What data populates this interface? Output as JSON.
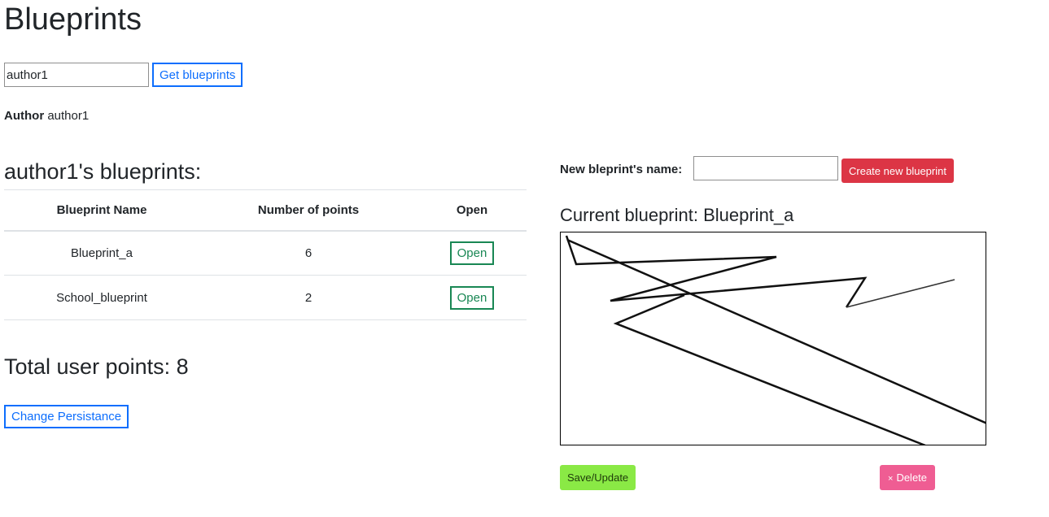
{
  "header": {
    "title": "Blueprints"
  },
  "search": {
    "value": "author1",
    "button_label": "Get blueprints"
  },
  "author": {
    "label": "Author",
    "name": "author1"
  },
  "list": {
    "title": "author1's blueprints:",
    "columns": [
      "Blueprint Name",
      "Number of points",
      "Open"
    ],
    "rows": [
      {
        "name": "Blueprint_a",
        "points": "6",
        "action": "Open"
      },
      {
        "name": "School_blueprint",
        "points": "2",
        "action": "Open"
      }
    ]
  },
  "total": {
    "text": "Total user points: 8"
  },
  "persistence": {
    "button_label": "Change Persistance"
  },
  "create": {
    "label": "New bleprint's name:",
    "value": "",
    "button_label": "Create new blueprint"
  },
  "current": {
    "title": "Current blueprint: Blueprint_a"
  },
  "actions": {
    "save_label": "Save/Update",
    "delete_icon": "×",
    "delete_label": "Delete"
  },
  "colors": {
    "primary": "#0d6efd",
    "success_outline": "#198754",
    "danger": "#dc3545",
    "save": "#8ae945",
    "delete": "#ef5d93"
  }
}
